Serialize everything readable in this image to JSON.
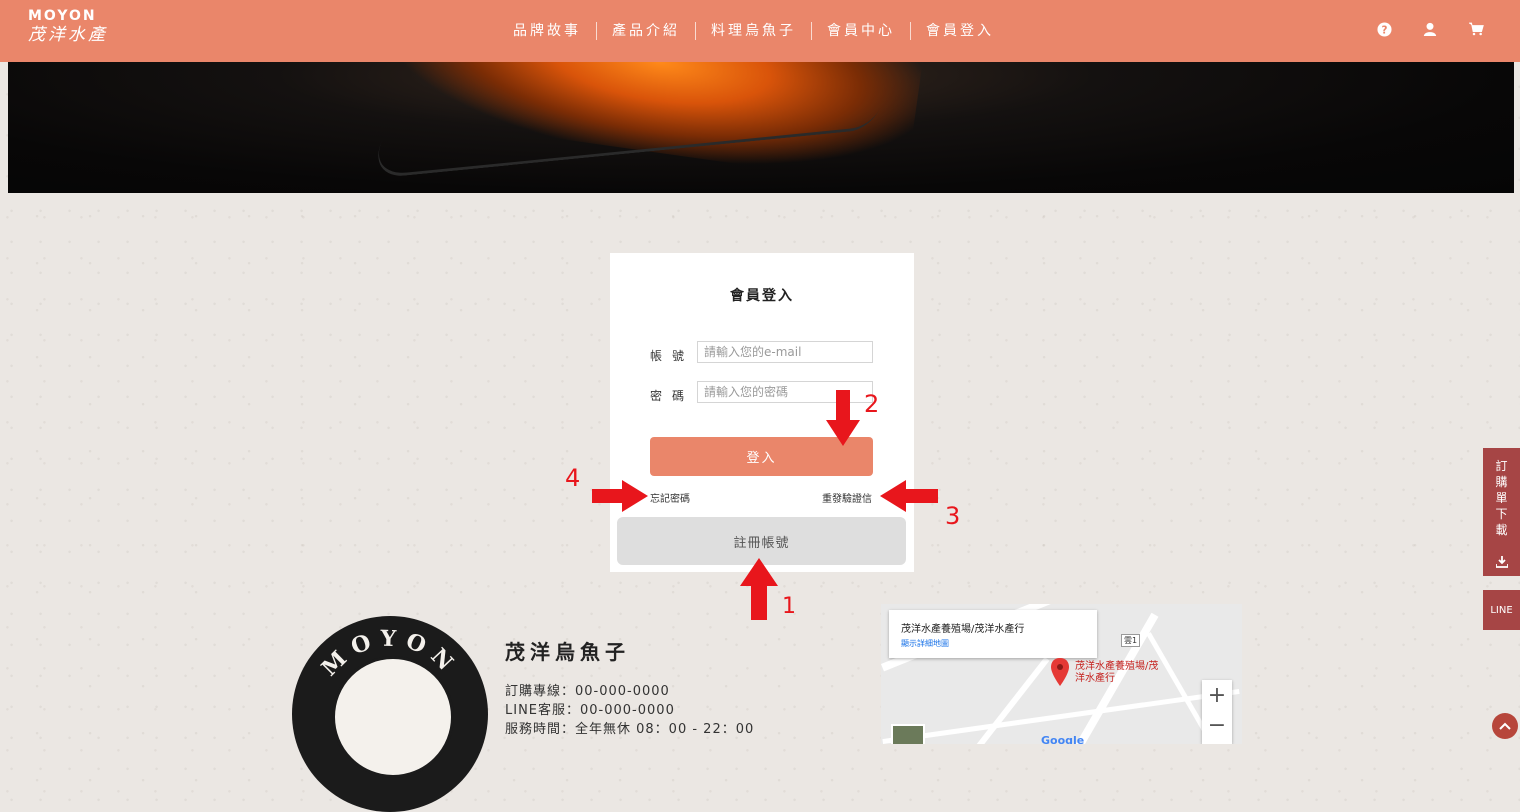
{
  "header": {
    "logo_en": "MOYON",
    "logo_zh": "茂洋水產",
    "nav": [
      "品牌故事",
      "產品介紹",
      "料理烏魚子",
      "會員中心",
      "會員登入"
    ],
    "icons": [
      "help-icon",
      "user-icon",
      "cart-icon"
    ]
  },
  "login": {
    "title": "會員登入",
    "account_label": "帳號",
    "account_placeholder": "請輸入您的e-mail",
    "password_label": "密碼",
    "password_placeholder": "請輸入您的密碼",
    "login_button": "登入",
    "forgot_password": "忘記密碼",
    "resend_verification": "重發驗證信",
    "register_button": "註冊帳號"
  },
  "annotations": [
    "1",
    "2",
    "3",
    "4"
  ],
  "side": {
    "order_download": "訂購單下載",
    "line": "LINE"
  },
  "footer": {
    "seal_text": "MOYON",
    "brand": "茂洋烏魚子",
    "lines": [
      "訂購專線：00-000-0000",
      "LINE客服：00-000-0000",
      "服務時間：全年無休 08：00 - 22：00"
    ]
  },
  "map": {
    "place_title": "茂洋水產養殖場/茂洋水產行",
    "view_larger": "顯示詳細地圖",
    "pin_label": "茂洋水產養殖場/茂洋水產行",
    "road_badge": "雲1",
    "zoom_in": "+",
    "zoom_out": "−",
    "brand": "Google"
  },
  "colors": {
    "accent": "#ea866a",
    "side_tab": "#a64545",
    "annotation_red": "#e8161c"
  }
}
